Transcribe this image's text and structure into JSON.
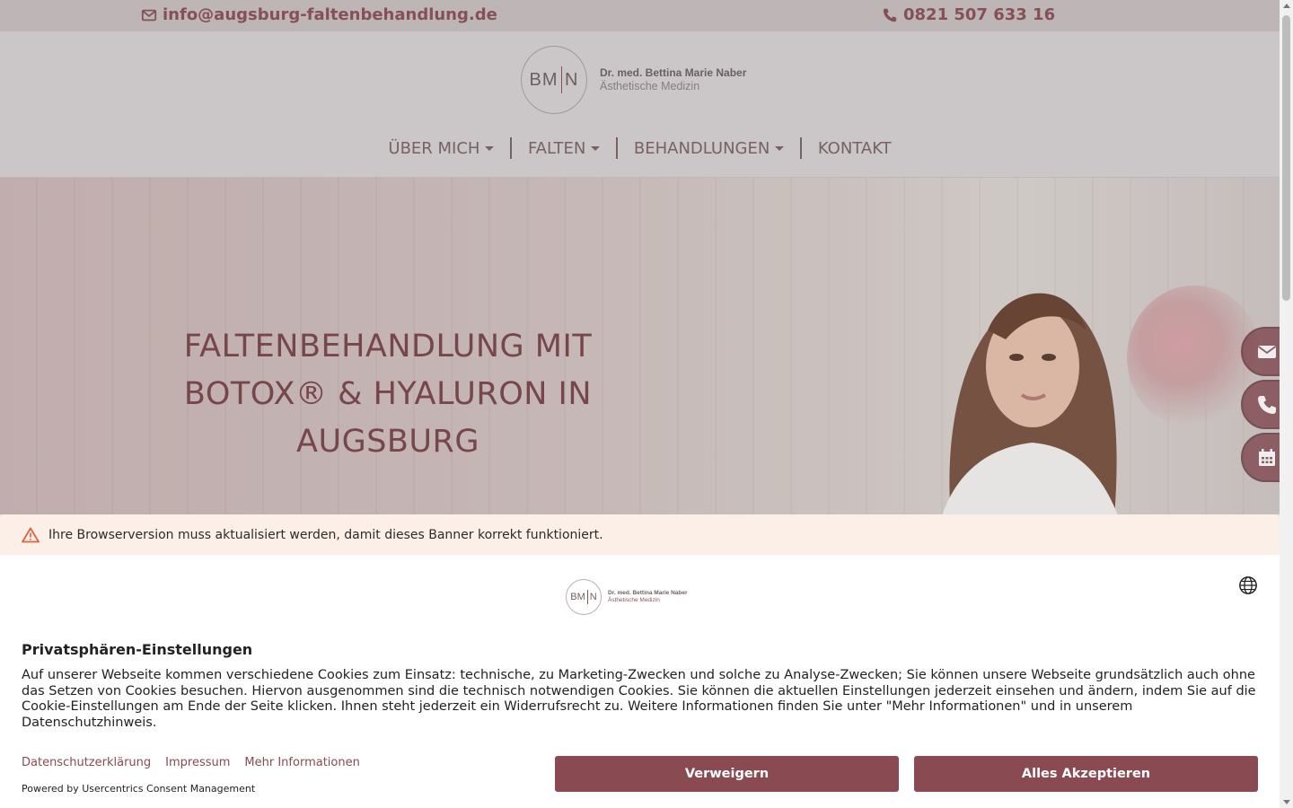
{
  "topbar": {
    "email": "info@augsburg-faltenbehandlung.de",
    "phone": "0821 507 633 16"
  },
  "logo": {
    "monogram_left": "BM",
    "monogram_right": "N",
    "name": "Dr. med. Bettina Marie Naber",
    "subtitle": "Ästhetische Medizin"
  },
  "nav": {
    "items": [
      {
        "label": "ÜBER MICH",
        "dropdown": true
      },
      {
        "label": "FALTEN",
        "dropdown": true
      },
      {
        "label": "BEHANDLUNGEN",
        "dropdown": true
      },
      {
        "label": "KONTAKT",
        "dropdown": false
      }
    ]
  },
  "hero": {
    "title": "FALTENBEHANDLUNG MIT BOTOX® & HYALURON IN AUGSBURG"
  },
  "side_buttons": [
    "envelope-icon",
    "phone-icon",
    "calendar-icon"
  ],
  "consent": {
    "warning": "Ihre Browserversion muss aktualisiert werden, damit dieses Banner korrekt funktioniert.",
    "title": "Privatsphären-Einstellungen",
    "body": "Auf unserer Webseite kommen verschiedene Cookies zum Einsatz: technische, zu Marketing-Zwecken und solche zu Analyse-Zwecken; Sie können unsere Webseite grundsätzlich auch ohne das Setzen von Cookies besuchen. Hiervon ausgenommen sind die technisch notwendigen Cookies. Sie können die aktuellen Einstellungen jederzeit einsehen und ändern, indem Sie auf die Cookie-Einstellungen am Ende der Seite klicken. Ihnen steht jederzeit ein Widerrufsrecht zu. Weitere Informationen finden Sie unter \"Mehr Informationen\" und in unserem Datenschutzhinweis.",
    "links": {
      "privacy": "Datenschutzerklärung",
      "imprint": "Impressum",
      "more": "Mehr Informationen"
    },
    "powered_by": "Powered by Usercentrics Consent Management",
    "deny_label": "Verweigern",
    "accept_label": "Alles Akzeptieren"
  },
  "colors": {
    "brand": "#8a4a51",
    "topbar_bg": "#c7bfc1",
    "header_bg": "#d6d3d4",
    "warning_bg": "#fcefe8"
  }
}
